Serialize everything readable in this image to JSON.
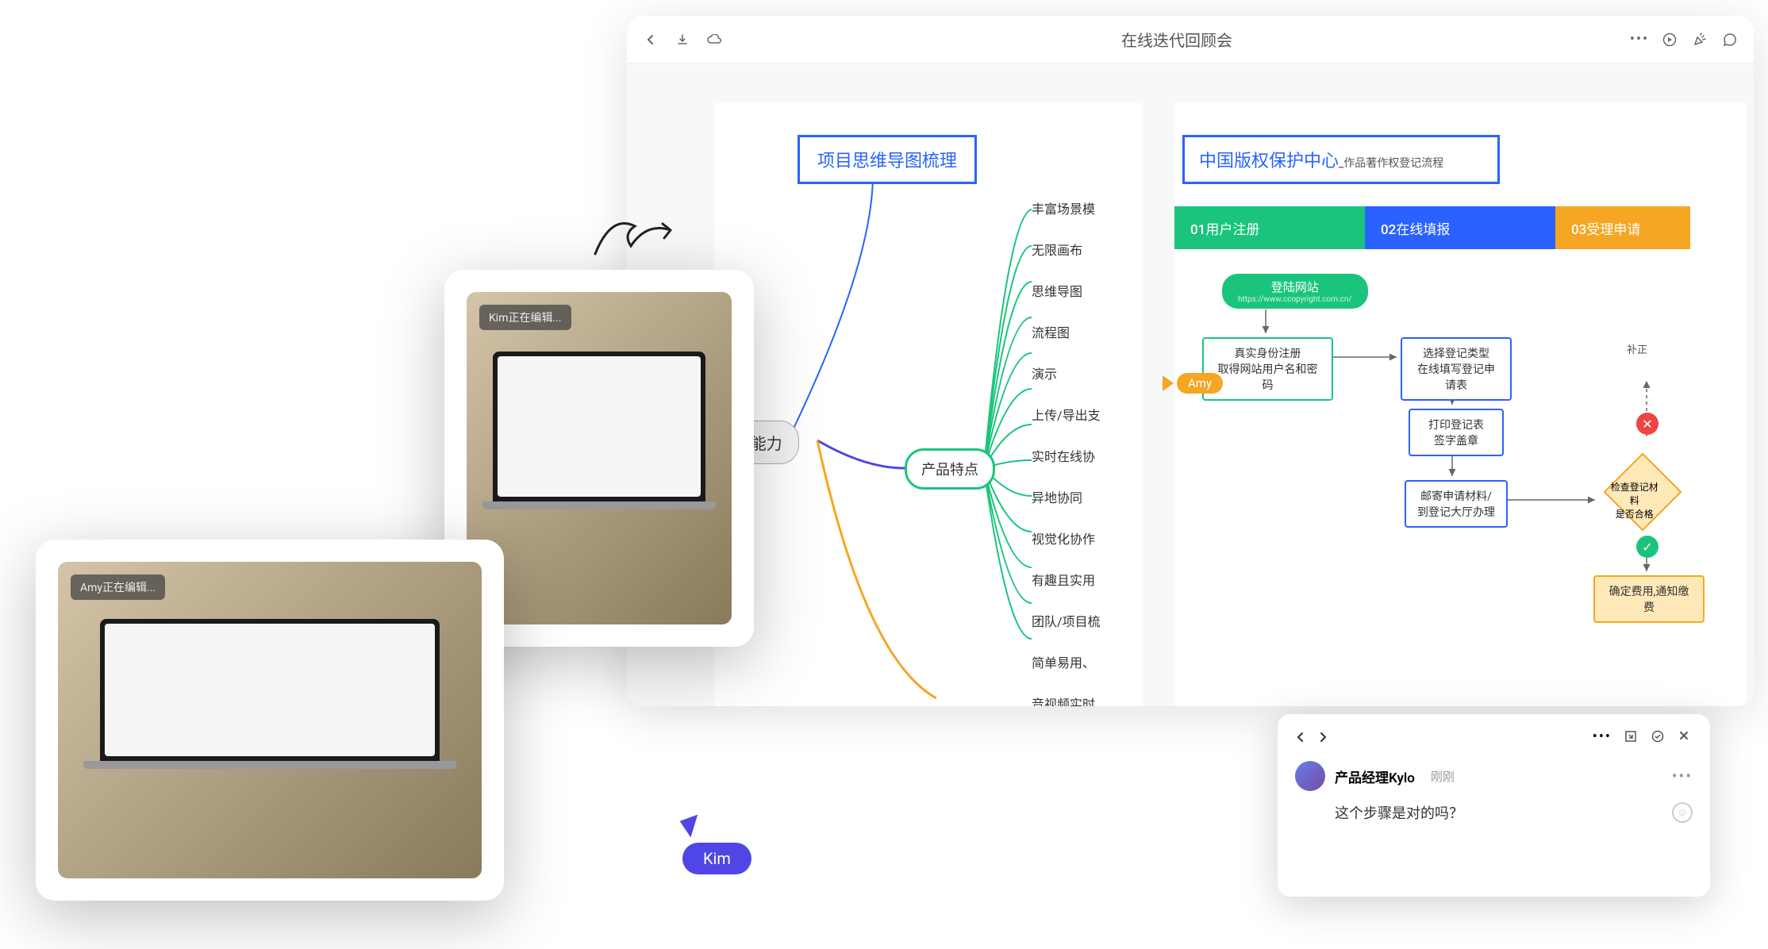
{
  "toolbar": {
    "title": "在线迭代回顾会"
  },
  "mindmap": {
    "title": "项目思维导图梳理",
    "root": "ix产品能力",
    "feature": "产品特点",
    "leaves": [
      "丰富场景模",
      "无限画布",
      "思维导图",
      "流程图",
      "演示",
      "上传/导出支",
      "实时在线协",
      "异地协同",
      "视觉化协作",
      "有趣且实用",
      "团队/项目梳",
      "简单易用、",
      "音视频实时"
    ]
  },
  "flowchart": {
    "title_main": "中国版权保护中心",
    "title_sub": "_作品著作权登记流程",
    "cols": [
      "01用户注册",
      "02在线填报",
      "03受理申请"
    ],
    "start_label": "登陆网站",
    "start_url": "https://www.ccopyright.com.cn/",
    "box1_l1": "真实身份注册",
    "box1_l2": "取得网站用户名和密码",
    "box2_l1": "选择登记类型",
    "box2_l2": "在线填写登记申请表",
    "box3_l1": "打印登记表",
    "box3_l2": "签字盖章",
    "box4_l1": "邮寄申请材料/",
    "box4_l2": "到登记大厅办理",
    "diamond1_l1": "检查登记材料",
    "diamond1_l2": "是否合格",
    "box5": "确定费用,通知缴费",
    "correction": "补正"
  },
  "amy": {
    "label": "Amy"
  },
  "kim": {
    "label": "Kim"
  },
  "photo_top": {
    "badge": "Kim正在编辑..."
  },
  "photo_bottom": {
    "badge": "Amy正在编辑..."
  },
  "comment": {
    "user": "产品经理Kylo",
    "time": "刚刚",
    "text": "这个步骤是对的吗？"
  }
}
